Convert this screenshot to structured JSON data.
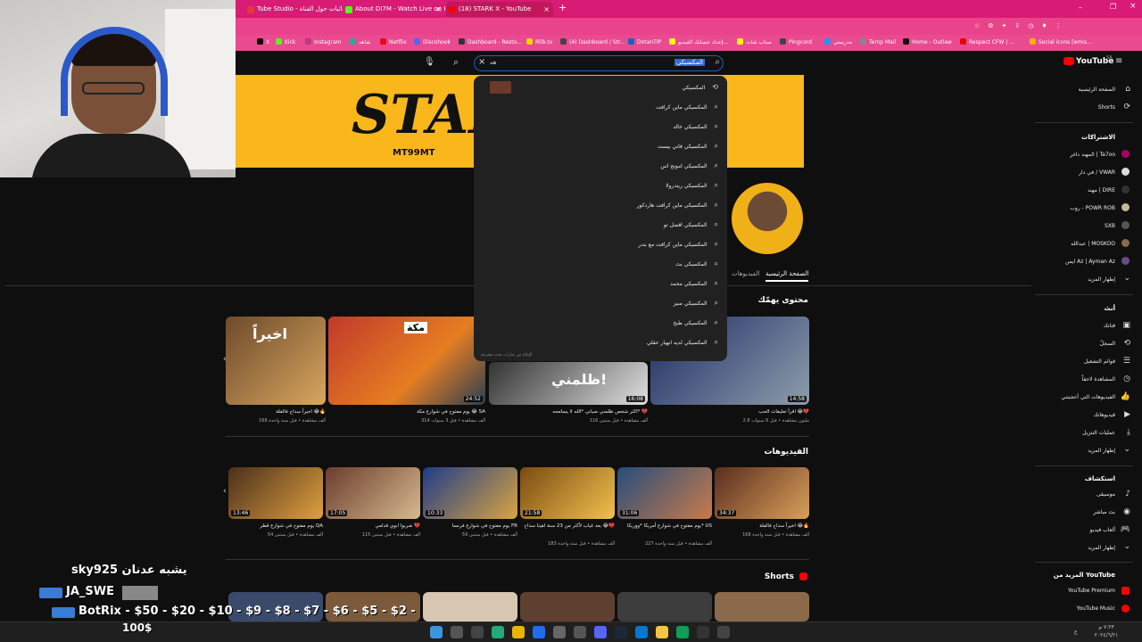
{
  "tabs": [
    {
      "label": "Tube Studio - إحصائيات حول القناة",
      "color": "#e53935"
    },
    {
      "label": "About DI7M - Watch Live on Kick",
      "color": "#53fc18"
    },
    {
      "label": "(18) STARK X - YouTube",
      "color": "#ff0000"
    }
  ],
  "bookmarks": [
    "X",
    "Kick",
    "Instagram",
    "شاهد",
    "Netflix",
    "Discohook",
    "Dashboard - Resto...",
    "Rlib.tv",
    "(4) Dashboard / Str...",
    "DotanTIP",
    "إعداد حسابك الفيديو...",
    "سناب شات",
    "Pingcord",
    "مدرستي",
    "Temp Mail",
    "Home - Outlaw",
    "Respect CFW | ...",
    "Social icons [emis..."
  ],
  "search": {
    "query": "المكسيكي",
    "typed": "هه"
  },
  "suggestions": [
    "المكسيكي",
    "المكسيكي ماين كرافت",
    "المكسيكي خالد",
    "المكسيكي فاني بيست",
    "المكسيكي امونج اس",
    "المكسيكي ريندرولا",
    "المكسيكي ماين كرافت هاردكور",
    "المكسيكي افضل تو",
    "المكسيكي ماين كرافت مع بندر",
    "المكسيكي بث",
    "المكسيكي محمد",
    "المكسيكي منيز",
    "المكسيكي طبخ",
    "المكسيكي لديه انهيار عقلي"
  ],
  "dropdown_footer": "الإبلاغ عن عبارات بحث مقترحة",
  "banner": {
    "logo": "STAR",
    "handle": "MT99MT"
  },
  "channel_tabs": {
    "home": "الصفحة الرئيسية",
    "videos": "الفيديوهات"
  },
  "section_for_you": "محتوى يهمّك",
  "section_videos": "الفيديوهات",
  "section_shorts": "Shorts",
  "for_you_videos": [
    {
      "title": "اخيراً سداح فالفلة 😂🔥",
      "meta": "168 ألف مشاهدة • قبل سنة واحدة",
      "duration": ""
    },
    {
      "title": "يوم مفتوح في شوارع مكة 😂 SA",
      "meta": "314 ألف مشاهدة • قبل 3 سنوات",
      "duration": "24:52"
    },
    {
      "title": "اكثر شخص ظلمني صباني *الله لا يسامحه* 💔",
      "meta": "116 ألف مشاهدة • قبل سنتين",
      "duration": "16:08"
    },
    {
      "title": "اقرأ تعليقات الحب 😂💔",
      "meta": "2.8 مليون مشاهدة • قبل 6 سنوات",
      "duration": "14:58"
    }
  ],
  "videos": [
    {
      "title": "يوم مفتوح في شوارع قطر QA",
      "meta": "54 ألف مشاهدة • قبل سنتين",
      "duration": "13:46"
    },
    {
      "title": "ضربوا ابوي قدامي 💔",
      "meta": "115 ألف مشاهدة • قبل سنتين",
      "duration": "17:05"
    },
    {
      "title": "يوم مفتوح في شوارع فرنسا FR",
      "meta": "59 ألف مشاهدة • قبل سنتين",
      "duration": "10:33"
    },
    {
      "title": "بعد غياب لأكثر من 23 سنة لقينا سداح 😂💔",
      "meta": "183 ألف مشاهدة • قبل سنة واحدة",
      "duration": "21:58"
    },
    {
      "title": "يوم مفتوح في شوارع أمريكا *ووريكا* US",
      "meta": "227 ألف مشاهدة • قبل سنة واحدة",
      "duration": "31:06"
    },
    {
      "title": "اخيراً سداح فالفلة 😂🔥",
      "meta": "168 ألف مشاهدة • قبل سنة واحدة",
      "duration": "34:37"
    }
  ],
  "sidebar": {
    "home": "الصفحة الرئيسية",
    "shorts": "Shorts",
    "subs_header": "الاشتراكات",
    "subs": [
      "المهند داغر | Ta7oo",
      "في دار / VWAR",
      "مهند | DIRE",
      "روب - POWR ROB",
      "SXB",
      "عبدالله | MOSKOO",
      "ايمن Az | Ayman Az"
    ],
    "show_more": "إظهار المزيد",
    "you_header": "أنت",
    "you": [
      "قناتك",
      "السجلّ",
      "قوائم التشغيل",
      "المشاهدة لاحقاً",
      "الفيديوهات التي أعجبتني",
      "فيديوهاتك",
      "عمليات التنزيل"
    ],
    "explore_header": "استكشاف",
    "explore": [
      "موسيقى",
      "بث مباشر",
      "ألعاب فيديو"
    ],
    "more_header": "المزيد من YouTube",
    "more": [
      "YouTube Premium",
      "YouTube Music"
    ],
    "logo": "YouTube",
    "logo_region": "SA"
  },
  "chat": {
    "line1": "sky925 يشبه عدنان",
    "line2": "JA_SWE",
    "line3": "BotRix - $50 - $20 - $10 - $9 - $8 - $7 - $6 - $5 - $2 -",
    "line4": "100$"
  },
  "taskbar": {
    "time": "٧:٢٣ م",
    "date": "٢٠٢٤/٦/٢١",
    "lang": "ع"
  }
}
